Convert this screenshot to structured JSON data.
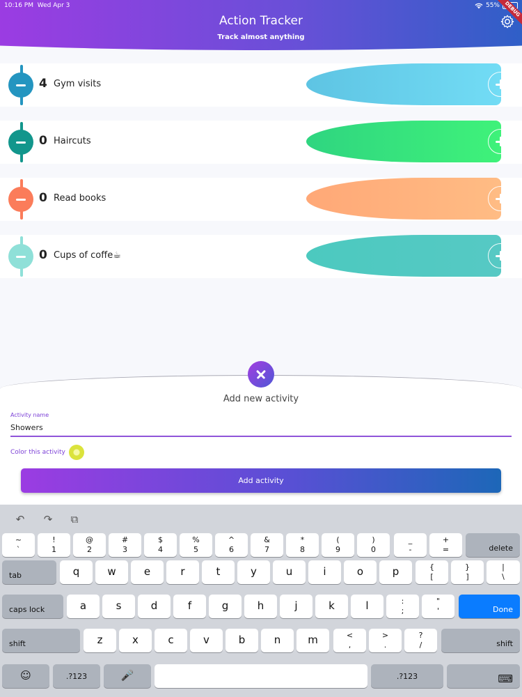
{
  "status_bar": {
    "time": "10:16 PM",
    "date": "Wed Apr 3",
    "battery": "55%"
  },
  "header": {
    "title": "Action Tracker",
    "subtitle": "Track almost anything",
    "debug_badge": "DEBUG"
  },
  "activities": [
    {
      "name": "Gym visits",
      "count": "4",
      "color": "#2495c0",
      "bar_start": "#5ec4e3",
      "bar_end": "#72dcf5"
    },
    {
      "name": "Haircuts",
      "count": "0",
      "color": "#12968c",
      "bar_start": "#2fd580",
      "bar_end": "#3ff27a"
    },
    {
      "name": "Read books",
      "count": "0",
      "color": "#fb7c5a",
      "bar_start": "#ffa877",
      "bar_end": "#ffbc84"
    },
    {
      "name": "Cups of coffe☕",
      "count": "0",
      "color": "#8fe0d8",
      "bar_start": "#4cc9bf",
      "bar_end": "#56c9c4"
    }
  ],
  "add_panel": {
    "title": "Add new activity",
    "field_label": "Activity name",
    "field_value": "Showers",
    "color_label": "Color this activity",
    "button_label": "Add activity"
  },
  "keyboard": {
    "row1": [
      [
        "~",
        "`"
      ],
      [
        "!",
        "1"
      ],
      [
        "@",
        "2"
      ],
      [
        "#",
        "3"
      ],
      [
        "$",
        "4"
      ],
      [
        "%",
        "5"
      ],
      [
        "^",
        "6"
      ],
      [
        "&",
        "7"
      ],
      [
        "*",
        "8"
      ],
      [
        "(",
        "9"
      ],
      [
        ")",
        "0"
      ],
      [
        "_",
        "-"
      ],
      [
        "+",
        "="
      ]
    ],
    "delete": "delete",
    "tab": "tab",
    "row2": [
      "q",
      "w",
      "e",
      "r",
      "t",
      "y",
      "u",
      "i",
      "o",
      "p"
    ],
    "row2_punct": [
      [
        "{",
        "["
      ],
      [
        "}",
        "]"
      ],
      [
        "|",
        "\\"
      ]
    ],
    "caps_lock": "caps lock",
    "row3": [
      "a",
      "s",
      "d",
      "f",
      "g",
      "h",
      "j",
      "k",
      "l"
    ],
    "row3_punct": [
      [
        ":",
        ";"
      ],
      [
        "\"",
        "'"
      ]
    ],
    "done": "Done",
    "shift": "shift",
    "row4": [
      "z",
      "x",
      "c",
      "v",
      "b",
      "n",
      "m"
    ],
    "row4_punct": [
      [
        "<",
        ","
      ],
      [
        ">",
        "."
      ],
      [
        "?",
        "/"
      ]
    ],
    "emoji": "☺",
    "numbers_left": ".?123",
    "mic": "🎤",
    "numbers_right": ".?123",
    "hide_keyboard": "⌨",
    "undo": "↶",
    "redo": "↷",
    "paste": "⧉"
  }
}
